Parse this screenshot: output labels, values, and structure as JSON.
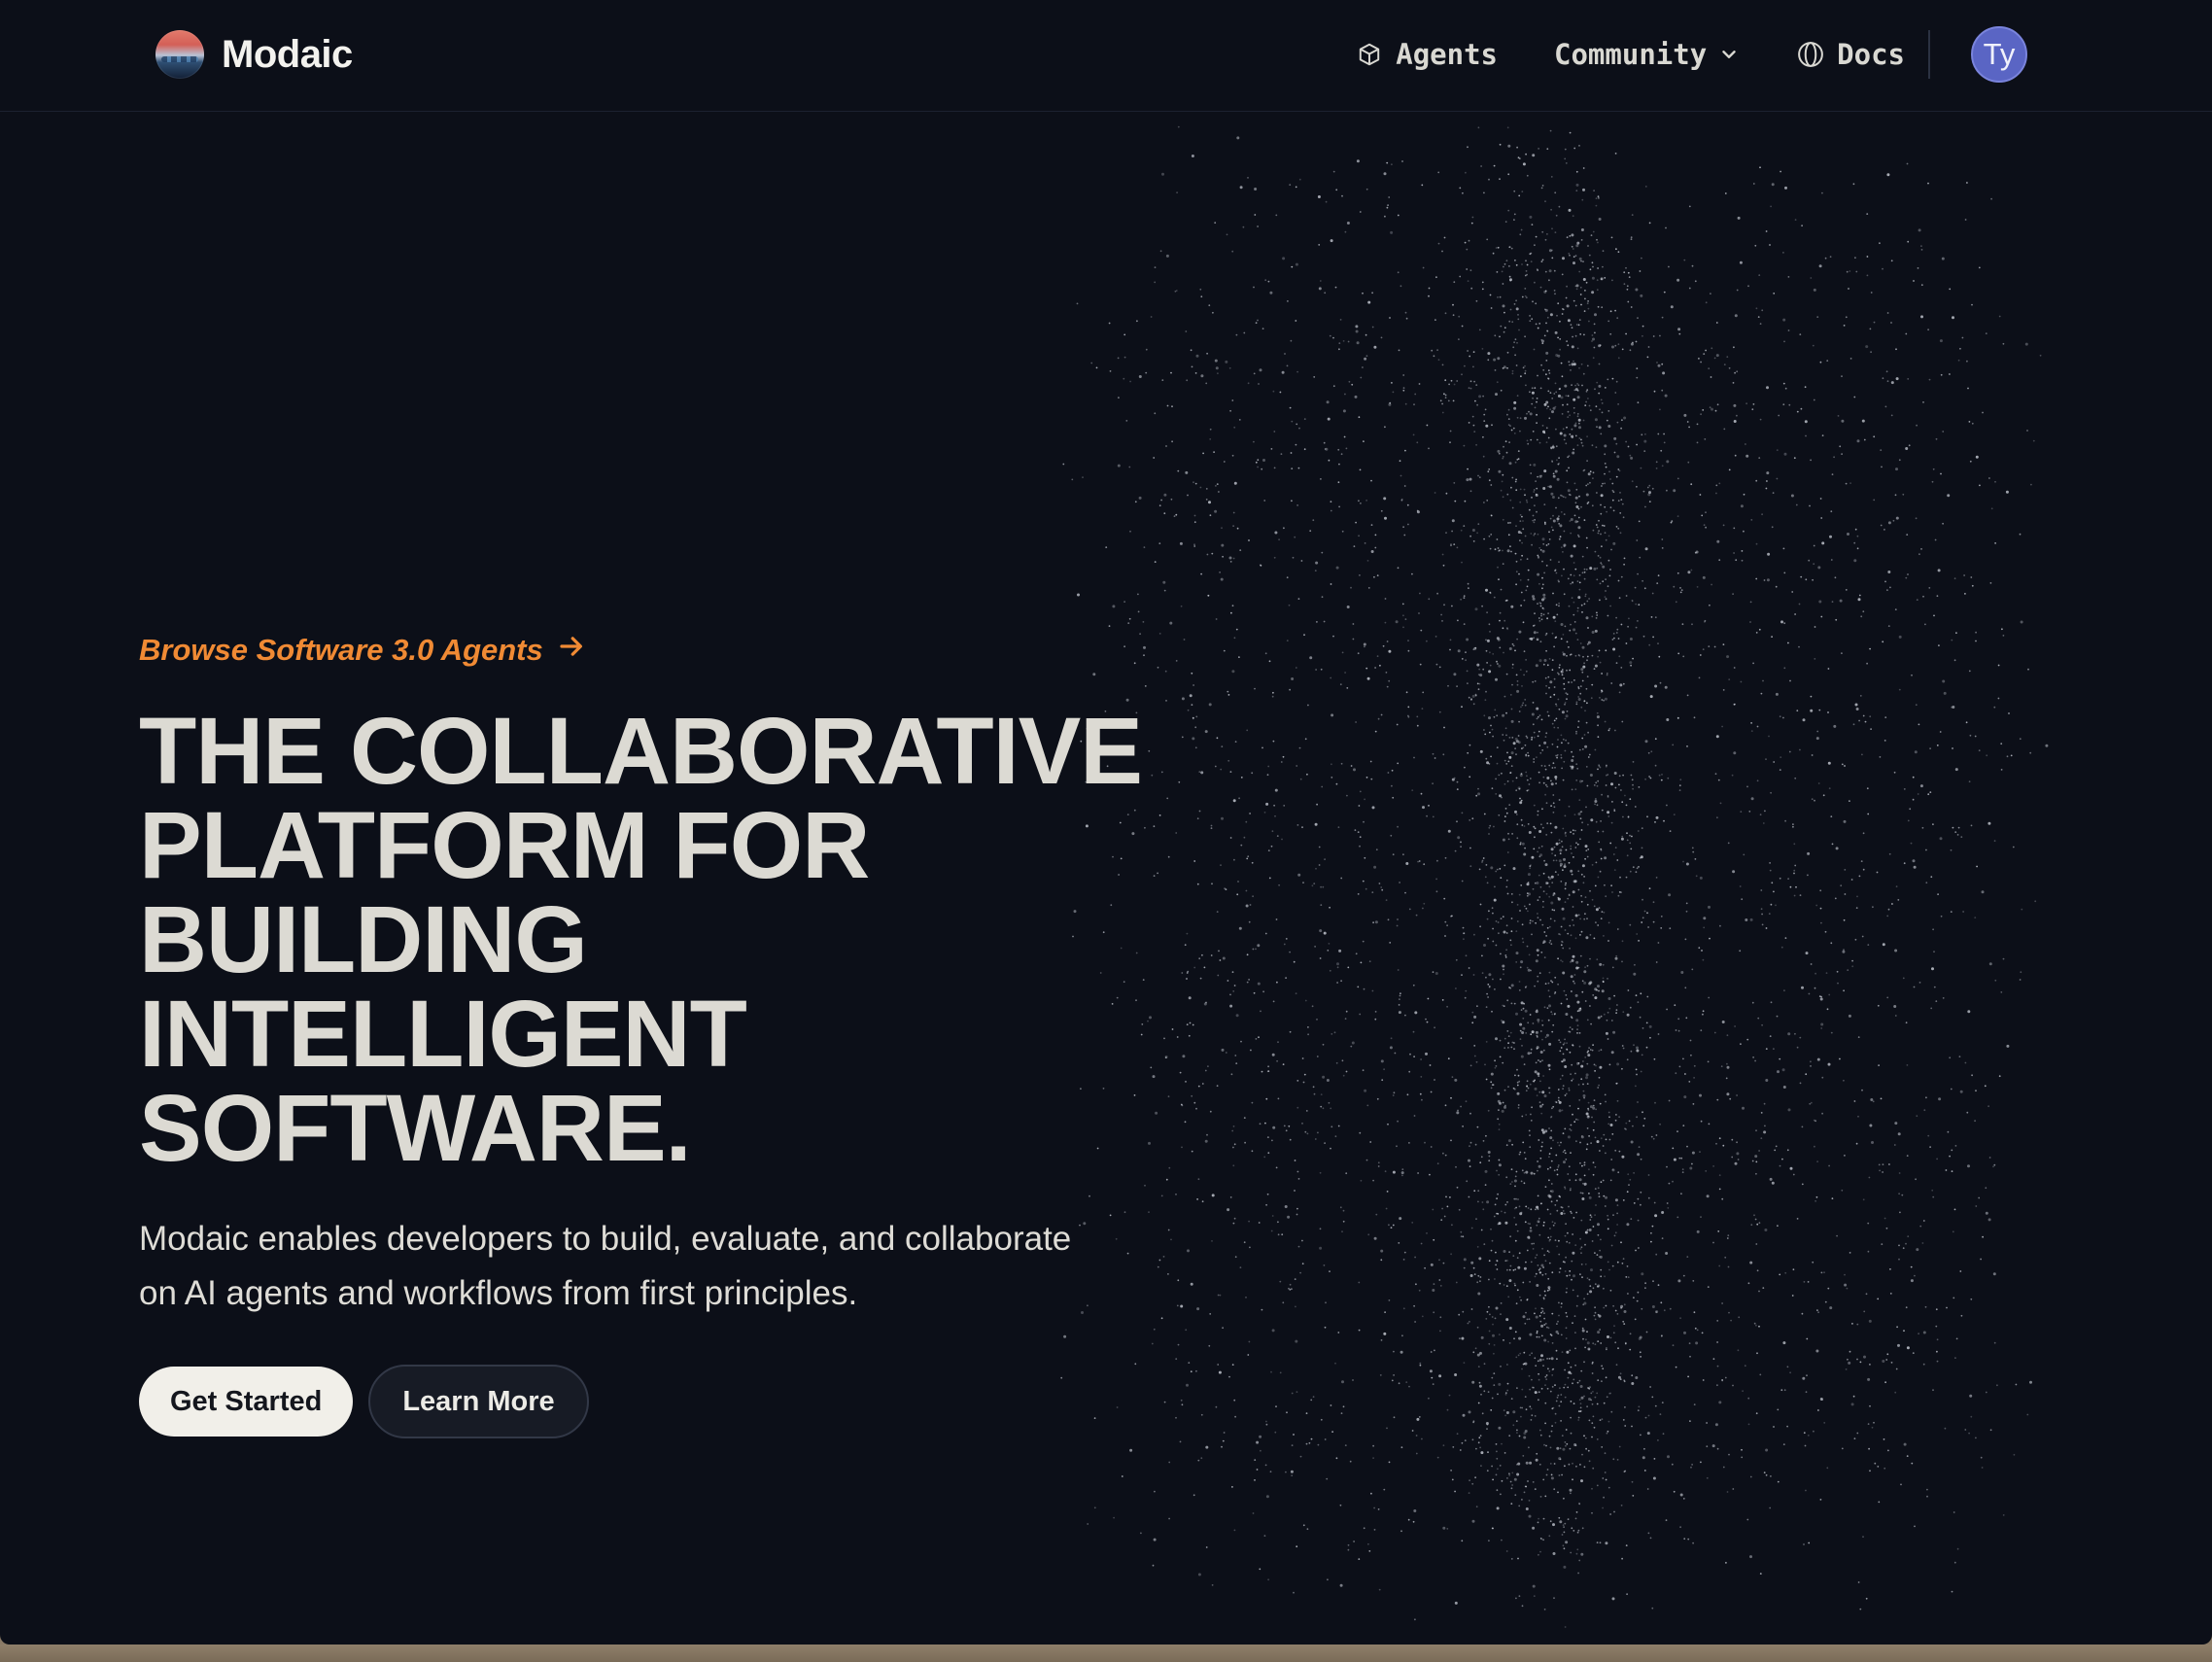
{
  "nav": {
    "brand": "Modaic",
    "links": [
      {
        "label": "Agents",
        "icon": "cube-icon"
      },
      {
        "label": "Community",
        "icon": "chevron-down-icon"
      },
      {
        "label": "Docs",
        "icon": "globe-icon"
      }
    ],
    "avatar_initials": "Ty"
  },
  "hero": {
    "eyebrow": "Browse Software 3.0 Agents",
    "headline_lines": [
      "THE COLLABORATIVE",
      "PLATFORM FOR BUILDING",
      "INTELLIGENT SOFTWARE."
    ],
    "subtext_lines": [
      "Modaic enables developers to build, evaluate, and collaborate",
      "on AI agents and workflows from first principles."
    ],
    "primary_cta": "Get Started",
    "secondary_cta": "Learn More"
  },
  "colors": {
    "background": "#0c0f18",
    "accent": "#f08a34",
    "headline": "#dcdad3",
    "avatar": "#5a65c4"
  }
}
